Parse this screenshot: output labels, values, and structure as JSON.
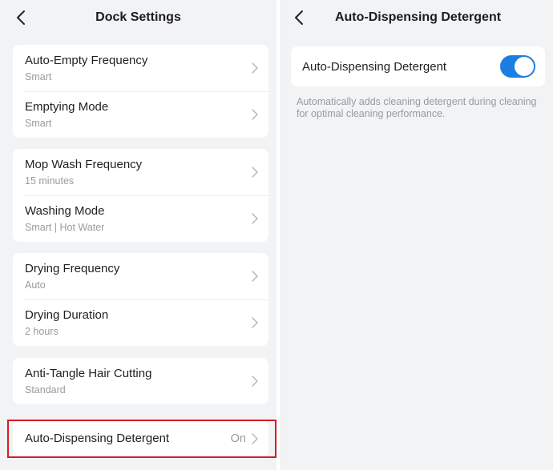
{
  "left": {
    "title": "Dock Settings",
    "groups": [
      {
        "items": [
          {
            "title": "Auto-Empty Frequency",
            "sub": "Smart"
          },
          {
            "title": "Emptying Mode",
            "sub": "Smart"
          }
        ]
      },
      {
        "items": [
          {
            "title": "Mop Wash Frequency",
            "sub": "15 minutes"
          },
          {
            "title": "Washing Mode",
            "sub": "Smart | Hot Water"
          }
        ]
      },
      {
        "items": [
          {
            "title": "Drying Frequency",
            "sub": "Auto"
          },
          {
            "title": "Drying Duration",
            "sub": "2 hours"
          }
        ]
      },
      {
        "items": [
          {
            "title": "Anti-Tangle Hair Cutting",
            "sub": "Standard"
          }
        ]
      }
    ],
    "detergent_row": {
      "title": "Auto-Dispensing Detergent",
      "value": "On"
    }
  },
  "right": {
    "title": "Auto-Dispensing Detergent",
    "toggle_label": "Auto-Dispensing Detergent",
    "toggle_on": true,
    "description": "Automatically adds cleaning detergent during cleaning for optimal cleaning performance."
  },
  "colors": {
    "background": "#f2f3f5",
    "card": "#ffffff",
    "accent": "#1c7ee0",
    "highlight": "#d91a24",
    "secondary_text": "#9a9a9a"
  },
  "icons": {
    "back": "chevron-left-icon",
    "row": "chevron-right-icon"
  }
}
